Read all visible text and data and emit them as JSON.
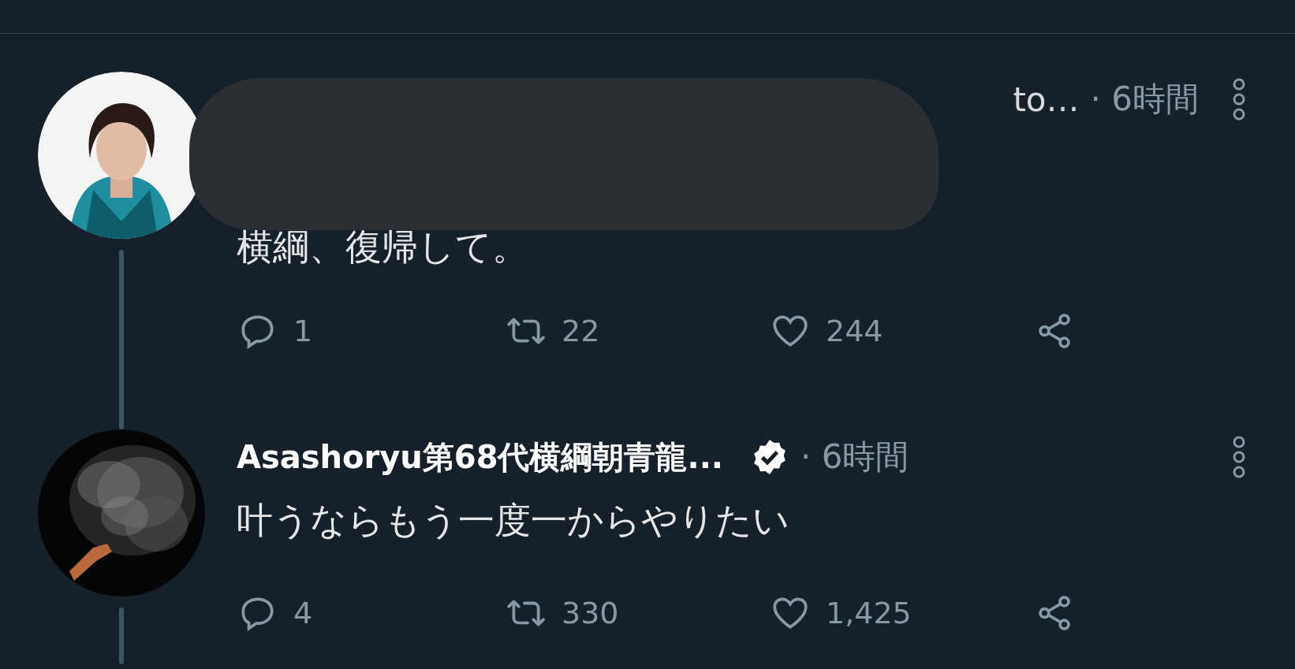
{
  "tweets": [
    {
      "author_name": "to…",
      "redacted": true,
      "verified": false,
      "time": "· 6時間",
      "text": "横綱、復帰して。",
      "replies": "1",
      "retweets": "22",
      "likes": "244",
      "thread_line_below": true
    },
    {
      "author_name": "Asashoryu第68代横綱朝青龍...",
      "redacted": false,
      "verified": true,
      "time": "· 6時間",
      "text": "叶うならもう一度一からやりたい",
      "replies": "4",
      "retweets": "330",
      "likes": "1,425",
      "thread_line_below": true
    }
  ]
}
